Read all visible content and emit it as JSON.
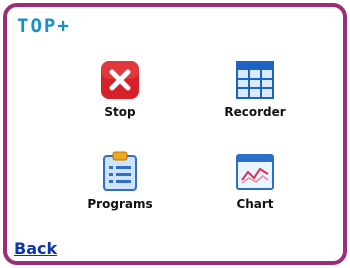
{
  "header": {
    "brand": "TOP+"
  },
  "menu": {
    "items": [
      {
        "label": "Stop",
        "icon": "stop-icon",
        "color": "#d6202a"
      },
      {
        "label": "Recorder",
        "icon": "recorder-icon",
        "color": "#1f63c4"
      },
      {
        "label": "Programs",
        "icon": "programs-icon",
        "color": "#2f6fc9"
      },
      {
        "label": "Chart",
        "icon": "chart-icon",
        "color": "#2a6fc8"
      }
    ]
  },
  "footer": {
    "back_label": "Back"
  },
  "theme": {
    "frame_color": "#9b2d78",
    "brand_color": "#1a8fc4",
    "link_color": "#0b37a8"
  }
}
